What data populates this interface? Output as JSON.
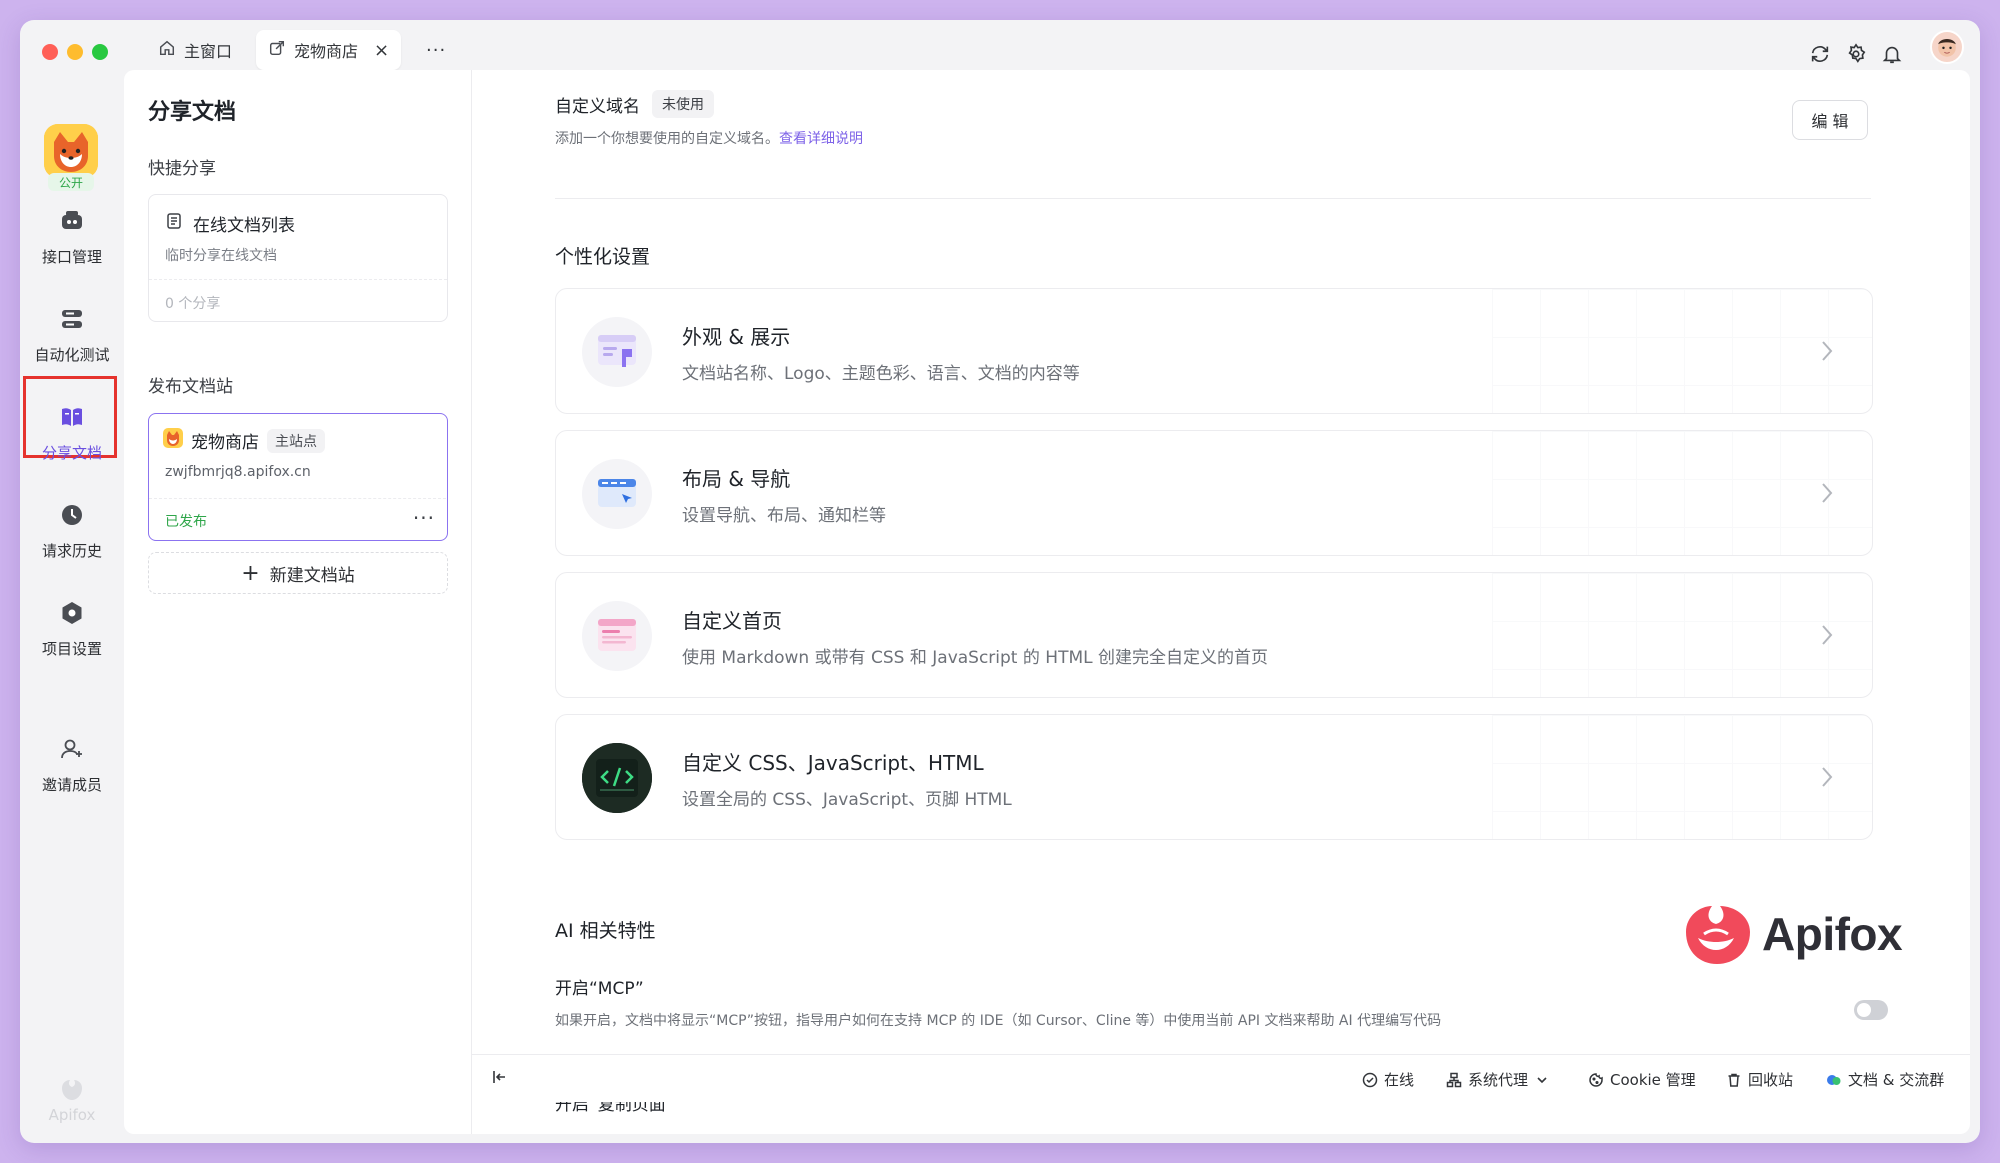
{
  "window": {
    "tabs": [
      {
        "label": "主窗口",
        "icon": "home-icon"
      },
      {
        "label": "宠物商店",
        "icon": "share-doc-icon",
        "active": true
      }
    ],
    "more_tabs": "···"
  },
  "nav": {
    "project_badge": "公开",
    "items": [
      {
        "label": "接口管理",
        "icon": "api-icon"
      },
      {
        "label": "自动化测试",
        "icon": "automation-icon"
      },
      {
        "label": "分享文档",
        "icon": "book-icon",
        "active": true
      },
      {
        "label": "请求历史",
        "icon": "clock-icon"
      },
      {
        "label": "项目设置",
        "icon": "settings-hex-icon"
      },
      {
        "label": "邀请成员",
        "icon": "add-user-icon"
      }
    ],
    "footer_brand": "Apifox"
  },
  "panel": {
    "title": "分享文档",
    "quick_share_label": "快捷分享",
    "quick_card": {
      "title": "在线文档列表",
      "subtitle": "临时分享在线文档",
      "count": "0 个分享"
    },
    "publish_label": "发布文档站",
    "site_card": {
      "name": "宠物商店",
      "badge": "主站点",
      "url": "zwjfbmrjq8.apifox.cn",
      "status": "已发布",
      "more": "···"
    },
    "new_site_label": "新建文档站",
    "new_site_plus": "+"
  },
  "main": {
    "domain": {
      "title": "自定义域名",
      "tag": "未使用",
      "desc": "添加一个你想要使用的自定义域名。",
      "link": "查看详细说明",
      "edit": "编 辑"
    },
    "personal_heading": "个性化设置",
    "cards": [
      {
        "title": "外观 & 展示",
        "desc": "文档站名称、Logo、主题色彩、语言、文档的内容等",
        "icon": "appearance-icon"
      },
      {
        "title": "布局 & 导航",
        "desc": "设置导航、布局、通知栏等",
        "icon": "layout-icon"
      },
      {
        "title": "自定义首页",
        "desc": "使用 Markdown 或带有 CSS 和 JavaScript 的 HTML 创建完全自定义的首页",
        "icon": "homepage-icon"
      },
      {
        "title": "自定义 CSS、JavaScript、HTML",
        "desc": "设置全局的 CSS、JavaScript、页脚 HTML",
        "icon": "code-icon"
      }
    ],
    "ai_heading": "AI 相关特性",
    "mcp": {
      "title": "开启“MCP”",
      "desc": "如果开启，文档中将显示“MCP”按钮，指导用户如何在支持 MCP 的 IDE（如 Cursor、Cline 等）中使用当前 API 文档来帮助 AI 代理编写代码",
      "enabled": false
    },
    "copy_page_title": "开启“复制页面”",
    "brand_word": "Apifox"
  },
  "bottombar": {
    "online": "在线",
    "proxy": "系统代理",
    "cookie": "Cookie 管理",
    "trash": "回收站",
    "community": "文档 & 交流群"
  },
  "colors": {
    "accent": "#6a4fe0",
    "published": "#2fa64a",
    "highlight_border": "#e5322d",
    "background": "#cdb3ee"
  }
}
